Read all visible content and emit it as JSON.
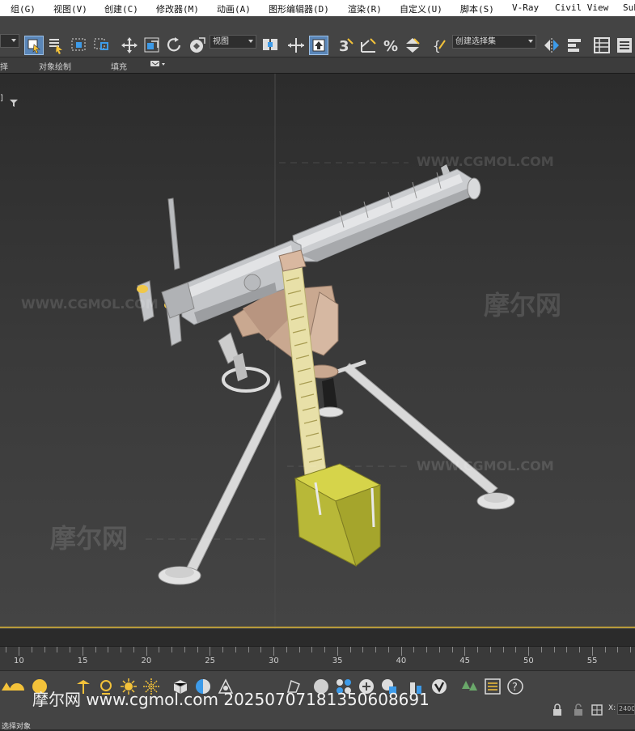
{
  "menu": {
    "items": [
      "组(G)",
      "视图(V)",
      "创建(C)",
      "修改器(M)",
      "动画(A)",
      "图形编辑器(D)",
      "渲染(R)",
      "自定义(U)",
      "脚本(S)",
      "V-Ray",
      "Civil View",
      "Sub"
    ]
  },
  "toolbar": {
    "view_dropdown": "视图",
    "selection_set_dropdown": "创建选择集",
    "icons": [
      "select-object-icon",
      "select-by-name-icon",
      "rectangular-selection-icon",
      "window-crossing-icon",
      "move-icon",
      "scale-icon",
      "rotate-icon",
      "place-icon",
      "mirror-icon",
      "align-icon",
      "snap-icon",
      "angle-snap-icon",
      "percent-snap-icon",
      "spinner-snap-icon",
      "edit-named-selection-icon",
      "scene-explorer-icon",
      "layer-explorer-icon"
    ]
  },
  "ribbon": {
    "left_fragment": "择",
    "object_paint": "对象绘制",
    "fill": "填充"
  },
  "viewport": {
    "label": "]",
    "watermarks": {
      "url": "WWW.CGMOL.COM",
      "brand": "摩尔网"
    }
  },
  "timeline": {
    "ticks": [
      "10",
      "15",
      "20",
      "25",
      "30",
      "35",
      "40",
      "45",
      "50",
      "55"
    ]
  },
  "bottom": {
    "footer_watermark": "摩尔网 www.cgmol.com 20250707181350608691",
    "status_text": "选择对象",
    "x_label": "X:",
    "x_value": "2400"
  },
  "colors": {
    "accent_active": "#5a86b8",
    "viewport_border": "#b89a3a",
    "gun_metal": "#c8cacd",
    "tripod": "#d9d9d9",
    "mount": "#c9a890",
    "ammo_box": "#b8b838",
    "ammo_belt": "#e8e0a8"
  }
}
